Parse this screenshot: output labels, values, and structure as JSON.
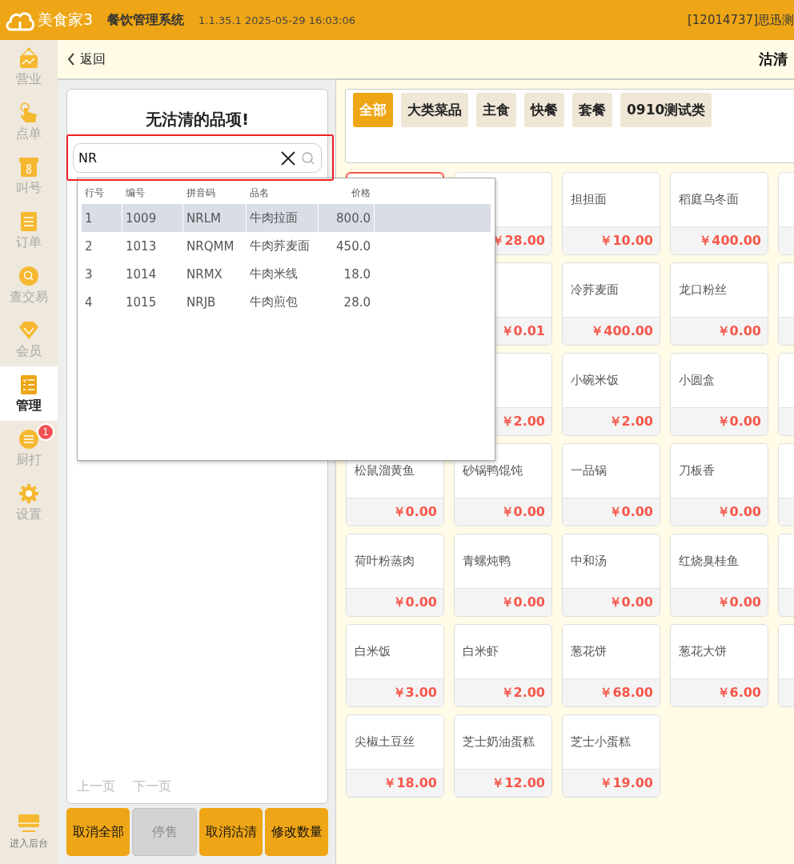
{
  "header": {
    "app_name": "美食家3",
    "system_name": "餐饮管理系统",
    "version": "1.1.35.1 2025-05-29 16:03:06",
    "user": "[12014737]思迅测"
  },
  "sidebar": {
    "items": [
      {
        "label": "营业",
        "kind": "sign",
        "selected": false
      },
      {
        "label": "点单",
        "kind": "hand",
        "selected": false
      },
      {
        "label": "叫号",
        "kind": "ticket",
        "selected": false
      },
      {
        "label": "订单",
        "kind": "doc",
        "selected": false
      },
      {
        "label": "查交易",
        "kind": "search",
        "selected": false
      },
      {
        "label": "会员",
        "kind": "diamond",
        "selected": false
      },
      {
        "label": "管理",
        "kind": "checklist",
        "selected": true
      },
      {
        "label": "厨打",
        "kind": "menu",
        "selected": false,
        "badge": "1"
      },
      {
        "label": "设置",
        "kind": "gear",
        "selected": false
      }
    ],
    "bottom": {
      "label": "进入后台"
    }
  },
  "toolbar": {
    "back": "返回",
    "title": "沽清"
  },
  "left_panel": {
    "title": "无沽清的品项!",
    "search": {
      "value": "NR"
    },
    "pager": [
      {
        "label": "上一页",
        "disabled": true
      },
      {
        "label": "下一页",
        "disabled": true
      }
    ],
    "buttons": [
      {
        "label": "取消全部",
        "disabled": false
      },
      {
        "label": "停售",
        "disabled": true
      },
      {
        "label": "取消沽清",
        "disabled": false
      },
      {
        "label": "修改数量",
        "disabled": false
      }
    ]
  },
  "dropdown": {
    "columns": [
      "行号",
      "编号",
      "拼音码",
      "品名",
      "价格"
    ],
    "rows": [
      {
        "cells": [
          "1",
          "1009",
          "NRLM",
          "牛肉拉面",
          "800.0"
        ],
        "selected": true
      },
      {
        "cells": [
          "2",
          "1013",
          "NRQMM",
          "牛肉荞麦面",
          "450.0"
        ],
        "selected": false
      },
      {
        "cells": [
          "3",
          "1014",
          "NRMX",
          "牛肉米线",
          "18.0"
        ],
        "selected": false
      },
      {
        "cells": [
          "4",
          "1015",
          "NRJB",
          "牛肉煎包",
          "28.0"
        ],
        "selected": false
      }
    ]
  },
  "categories": [
    {
      "label": "全部",
      "selected": true
    },
    {
      "label": "大类菜品",
      "selected": false
    },
    {
      "label": "主食",
      "selected": false
    },
    {
      "label": "快餐",
      "selected": false
    },
    {
      "label": "套餐",
      "selected": false
    },
    {
      "label": "0910测试类",
      "selected": false
    }
  ],
  "dishes": [
    {
      "kind": "dish",
      "selected": true
    },
    {
      "kind": "dish",
      "price": "￥28.00",
      "selected": false
    },
    {
      "kind": "dish",
      "name": "担担面",
      "price": "￥10.00",
      "selected": false
    },
    {
      "kind": "dish",
      "name": "稻庭乌冬面",
      "price": "￥400.00",
      "selected": false
    },
    {
      "kind": "dish",
      "selected": false
    },
    {
      "kind": "covered"
    },
    {
      "kind": "dish",
      "price": "￥0.01",
      "selected": false
    },
    {
      "kind": "dish",
      "name": "冷荞麦面",
      "price": "￥400.00",
      "selected": false
    },
    {
      "kind": "dish",
      "name": "龙口粉丝",
      "price": "￥0.00",
      "selected": false
    },
    {
      "kind": "dish",
      "selected": false
    },
    {
      "kind": "covered"
    },
    {
      "kind": "dish",
      "price": "￥2.00",
      "selected": false
    },
    {
      "kind": "dish",
      "name": "小碗米饭",
      "price": "￥2.00",
      "selected": false
    },
    {
      "kind": "dish",
      "name": "小圆盒",
      "price": "￥0.00",
      "selected": false
    },
    {
      "kind": "dish",
      "selected": false
    },
    {
      "kind": "dish",
      "name": "松鼠溜黄鱼",
      "price": "￥0.00",
      "selected": false
    },
    {
      "kind": "dish",
      "name": "砂锅鸭馄饨",
      "price": "￥0.00",
      "selected": false
    },
    {
      "kind": "dish",
      "name": "一品锅",
      "price": "￥0.00",
      "selected": false
    },
    {
      "kind": "dish",
      "name": "刀板香",
      "price": "￥0.00",
      "selected": false
    },
    {
      "kind": "dish",
      "selected": false
    },
    {
      "kind": "dish",
      "name": "荷叶粉蒸肉",
      "price": "￥0.00",
      "selected": false
    },
    {
      "kind": "dish",
      "name": "青螺炖鸭",
      "price": "￥0.00",
      "selected": false
    },
    {
      "kind": "dish",
      "name": "中和汤",
      "price": "￥0.00",
      "selected": false
    },
    {
      "kind": "dish",
      "name": "红烧臭桂鱼",
      "price": "￥0.00",
      "selected": false
    },
    {
      "kind": "dish",
      "selected": false
    },
    {
      "kind": "dish",
      "name": "白米饭",
      "price": "￥3.00",
      "selected": false
    },
    {
      "kind": "dish",
      "name": "白米虾",
      "price": "￥2.00",
      "selected": false
    },
    {
      "kind": "dish",
      "name": "葱花饼",
      "price": "￥68.00",
      "selected": false
    },
    {
      "kind": "dish",
      "name": "葱花大饼",
      "price": "￥6.00",
      "selected": false
    },
    {
      "kind": "dish",
      "selected": false
    },
    {
      "kind": "dish",
      "name": "尖椒土豆丝",
      "price": "￥18.00",
      "selected": false
    },
    {
      "kind": "dish",
      "name": "芝士奶油蛋糕",
      "price": "￥12.00",
      "selected": false
    },
    {
      "kind": "dish",
      "name": "芝士小蛋糕",
      "price": "￥19.00",
      "selected": false
    }
  ]
}
